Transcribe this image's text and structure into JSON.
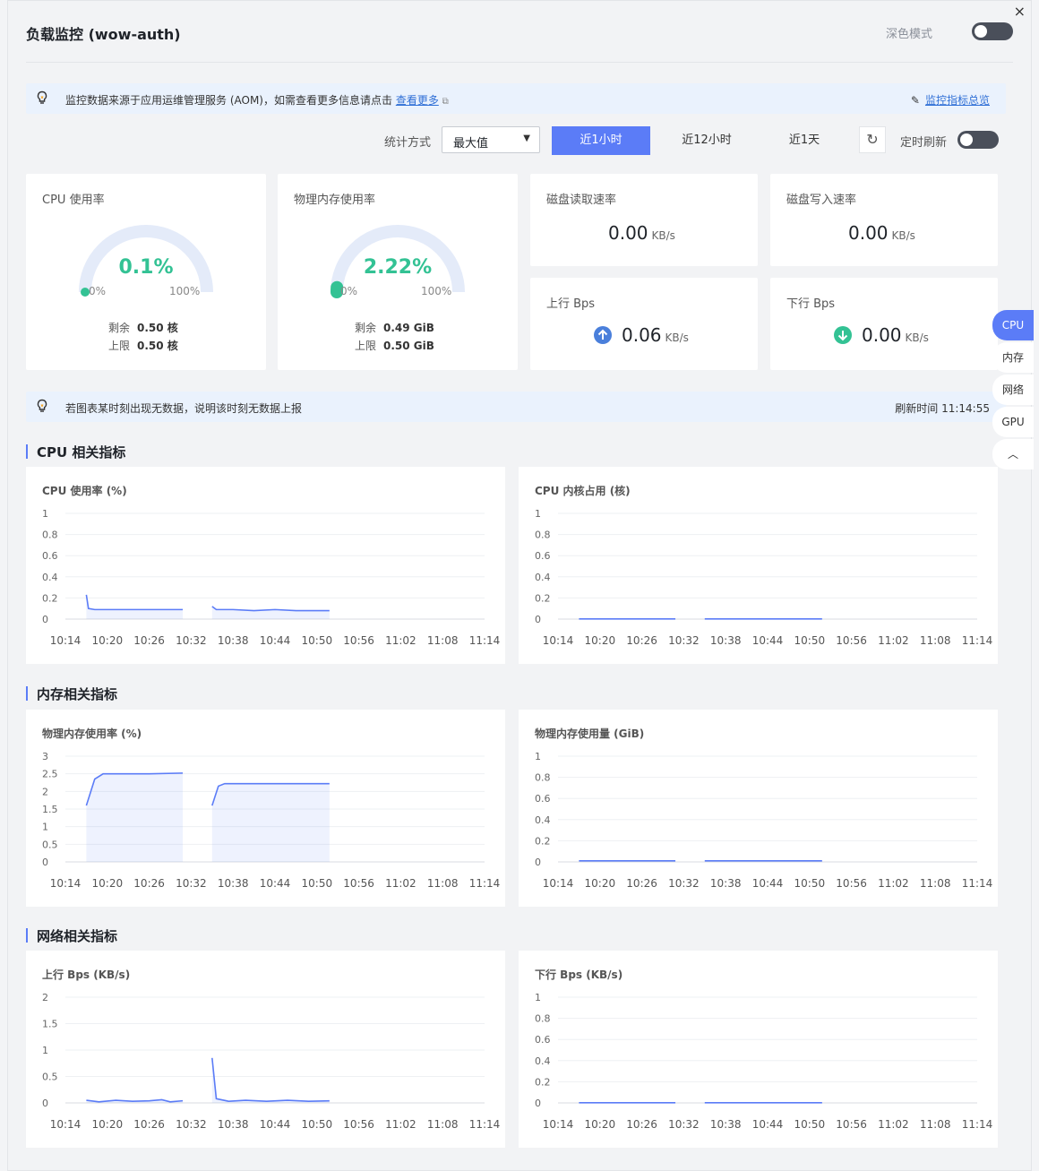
{
  "header": {
    "title": "负载监控 (wow-auth)",
    "dark_mode_label": "深色模式",
    "close_glyph": "×"
  },
  "notice1": {
    "text": "监控数据来源于应用运维管理服务 (AOM)，如需查看更多信息请点击",
    "link": "查看更多",
    "right": "监控指标总览"
  },
  "toolbar": {
    "stat_label": "统计方式",
    "stat_value": "最大值",
    "ranges": [
      "近1小时",
      "近12小时",
      "近1天"
    ],
    "active_range": 0,
    "timer_label": "定时刷新"
  },
  "summary": {
    "cpu": {
      "title": "CPU 使用率",
      "pct": "0.1%",
      "pct_value": 0.1,
      "min": "0%",
      "max": "100%",
      "remain_label": "剩余",
      "remain": "0.50 核",
      "limit_label": "上限",
      "limit": "0.50 核"
    },
    "mem": {
      "title": "物理内存使用率",
      "pct": "2.22%",
      "pct_value": 2.22,
      "min": "0%",
      "max": "100%",
      "remain_label": "剩余",
      "remain": "0.49 GiB",
      "limit_label": "上限",
      "limit": "0.50 GiB"
    },
    "disk_read": {
      "title": "磁盘读取速率",
      "value": "0.00",
      "unit": "KB/s"
    },
    "disk_write": {
      "title": "磁盘写入速率",
      "value": "0.00",
      "unit": "KB/s"
    },
    "up": {
      "title": "上行 Bps",
      "value": "0.06",
      "unit": "KB/s"
    },
    "down": {
      "title": "下行 Bps",
      "value": "0.00",
      "unit": "KB/s"
    }
  },
  "notice2": {
    "text": "若图表某时刻出现无数据，说明该时刻无数据上报",
    "refresh": "刷新时间 11:14:55"
  },
  "sections": {
    "cpu": "CPU 相关指标",
    "mem": "内存相关指标",
    "net": "网络相关指标"
  },
  "side_tabs": [
    "CPU",
    "内存",
    "网络",
    "GPU"
  ],
  "side_up": "︿",
  "colors": {
    "accent": "#5b7cf7",
    "green": "#33c294",
    "gauge_track": "#e4ebf9"
  },
  "chart_data": [
    {
      "id": "cpu-usage",
      "type": "area",
      "title": "CPU 使用率 (%)",
      "x": [
        "10:14",
        "10:20",
        "10:26",
        "10:32",
        "10:38",
        "10:44",
        "10:50",
        "10:56",
        "11:02",
        "11:08",
        "11:14"
      ],
      "yticks": [
        "0",
        "0.2",
        "0.4",
        "0.6",
        "0.8",
        "1"
      ],
      "ylim": [
        0,
        1
      ],
      "segments": [
        [
          [
            10.5,
            0.23
          ],
          [
            10.55,
            0.1
          ],
          [
            10.7,
            0.09
          ],
          [
            11.0,
            0.09
          ],
          [
            11.5,
            0.09
          ],
          [
            12.0,
            0.09
          ],
          [
            12.5,
            0.09
          ],
          [
            12.8,
            0.09
          ]
        ],
        [
          [
            13.5,
            0.12
          ],
          [
            13.6,
            0.09
          ],
          [
            14.0,
            0.09
          ],
          [
            14.5,
            0.08
          ],
          [
            15.0,
            0.09
          ],
          [
            15.5,
            0.08
          ],
          [
            16.0,
            0.08
          ],
          [
            16.3,
            0.08
          ]
        ]
      ]
    },
    {
      "id": "cpu-cores",
      "type": "line",
      "title": "CPU 内核占用 (核)",
      "x": [
        "10:14",
        "10:20",
        "10:26",
        "10:32",
        "10:38",
        "10:44",
        "10:50",
        "10:56",
        "11:02",
        "11:08",
        "11:14"
      ],
      "yticks": [
        "0",
        "0.2",
        "0.4",
        "0.6",
        "0.8",
        "1"
      ],
      "ylim": [
        0,
        1
      ],
      "segments": [
        [
          [
            10.5,
            0.002
          ],
          [
            12.8,
            0.002
          ]
        ],
        [
          [
            13.5,
            0.002
          ],
          [
            16.3,
            0.002
          ]
        ]
      ]
    },
    {
      "id": "mem-usage",
      "type": "area",
      "title": "物理内存使用率 (%)",
      "x": [
        "10:14",
        "10:20",
        "10:26",
        "10:32",
        "10:38",
        "10:44",
        "10:50",
        "10:56",
        "11:02",
        "11:08",
        "11:14"
      ],
      "yticks": [
        "0",
        "0.5",
        "1",
        "1.5",
        "2",
        "2.5",
        "3"
      ],
      "ylim": [
        0,
        3
      ],
      "segments": [
        [
          [
            10.5,
            1.6
          ],
          [
            10.7,
            2.35
          ],
          [
            10.9,
            2.5
          ],
          [
            11.5,
            2.5
          ],
          [
            12.0,
            2.5
          ],
          [
            12.8,
            2.52
          ]
        ],
        [
          [
            13.5,
            1.6
          ],
          [
            13.65,
            2.15
          ],
          [
            13.8,
            2.22
          ],
          [
            14.5,
            2.22
          ],
          [
            15.5,
            2.22
          ],
          [
            16.3,
            2.22
          ]
        ]
      ]
    },
    {
      "id": "mem-used",
      "type": "line",
      "title": "物理内存使用量 (GiB)",
      "x": [
        "10:14",
        "10:20",
        "10:26",
        "10:32",
        "10:38",
        "10:44",
        "10:50",
        "10:56",
        "11:02",
        "11:08",
        "11:14"
      ],
      "yticks": [
        "0",
        "0.2",
        "0.4",
        "0.6",
        "0.8",
        "1"
      ],
      "ylim": [
        0,
        1
      ],
      "segments": [
        [
          [
            10.5,
            0.01
          ],
          [
            12.8,
            0.01
          ]
        ],
        [
          [
            13.5,
            0.01
          ],
          [
            16.3,
            0.01
          ]
        ]
      ]
    },
    {
      "id": "net-up",
      "type": "area",
      "title": "上行 Bps (KB/s)",
      "x": [
        "10:14",
        "10:20",
        "10:26",
        "10:32",
        "10:38",
        "10:44",
        "10:50",
        "10:56",
        "11:02",
        "11:08",
        "11:14"
      ],
      "yticks": [
        "0",
        "0.5",
        "1",
        "1.5",
        "2"
      ],
      "ylim": [
        0,
        2
      ],
      "segments": [
        [
          [
            10.5,
            0.05
          ],
          [
            10.8,
            0.02
          ],
          [
            11.2,
            0.05
          ],
          [
            11.6,
            0.03
          ],
          [
            12.0,
            0.04
          ],
          [
            12.3,
            0.06
          ],
          [
            12.5,
            0.02
          ],
          [
            12.8,
            0.04
          ]
        ],
        [
          [
            13.5,
            0.85
          ],
          [
            13.6,
            0.08
          ],
          [
            13.9,
            0.03
          ],
          [
            14.3,
            0.05
          ],
          [
            14.8,
            0.03
          ],
          [
            15.3,
            0.05
          ],
          [
            15.8,
            0.03
          ],
          [
            16.3,
            0.04
          ]
        ]
      ]
    },
    {
      "id": "net-down",
      "type": "line",
      "title": "下行 Bps (KB/s)",
      "x": [
        "10:14",
        "10:20",
        "10:26",
        "10:32",
        "10:38",
        "10:44",
        "10:50",
        "10:56",
        "11:02",
        "11:08",
        "11:14"
      ],
      "yticks": [
        "0",
        "0.2",
        "0.4",
        "0.6",
        "0.8",
        "1"
      ],
      "ylim": [
        0,
        1
      ],
      "segments": [
        [
          [
            10.5,
            0.002
          ],
          [
            12.8,
            0.002
          ]
        ],
        [
          [
            13.5,
            0.002
          ],
          [
            16.3,
            0.002
          ]
        ]
      ]
    }
  ]
}
